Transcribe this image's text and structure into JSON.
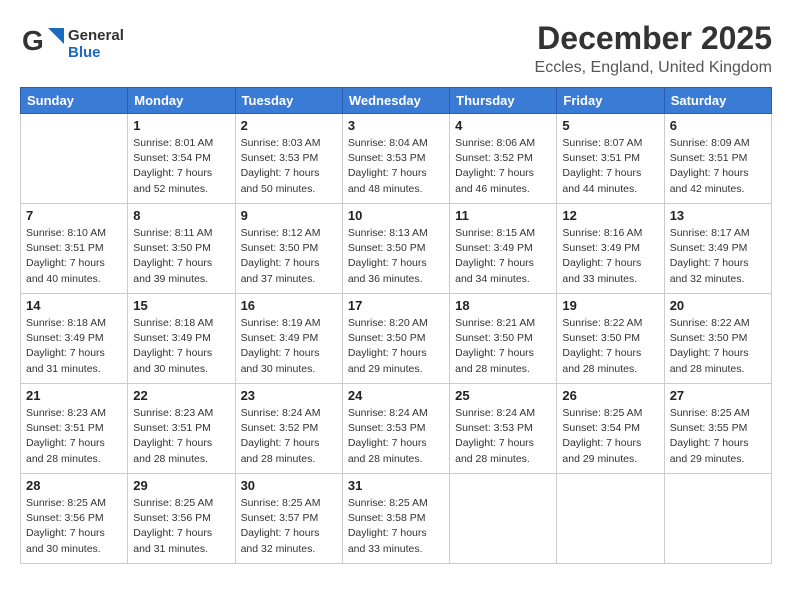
{
  "logo": {
    "general": "General",
    "blue": "Blue"
  },
  "header": {
    "month": "December 2025",
    "location": "Eccles, England, United Kingdom"
  },
  "weekdays": [
    "Sunday",
    "Monday",
    "Tuesday",
    "Wednesday",
    "Thursday",
    "Friday",
    "Saturday"
  ],
  "weeks": [
    [
      {
        "day": "",
        "sunrise": "",
        "sunset": "",
        "daylight": ""
      },
      {
        "day": "1",
        "sunrise": "Sunrise: 8:01 AM",
        "sunset": "Sunset: 3:54 PM",
        "daylight": "Daylight: 7 hours and 52 minutes."
      },
      {
        "day": "2",
        "sunrise": "Sunrise: 8:03 AM",
        "sunset": "Sunset: 3:53 PM",
        "daylight": "Daylight: 7 hours and 50 minutes."
      },
      {
        "day": "3",
        "sunrise": "Sunrise: 8:04 AM",
        "sunset": "Sunset: 3:53 PM",
        "daylight": "Daylight: 7 hours and 48 minutes."
      },
      {
        "day": "4",
        "sunrise": "Sunrise: 8:06 AM",
        "sunset": "Sunset: 3:52 PM",
        "daylight": "Daylight: 7 hours and 46 minutes."
      },
      {
        "day": "5",
        "sunrise": "Sunrise: 8:07 AM",
        "sunset": "Sunset: 3:51 PM",
        "daylight": "Daylight: 7 hours and 44 minutes."
      },
      {
        "day": "6",
        "sunrise": "Sunrise: 8:09 AM",
        "sunset": "Sunset: 3:51 PM",
        "daylight": "Daylight: 7 hours and 42 minutes."
      }
    ],
    [
      {
        "day": "7",
        "sunrise": "Sunrise: 8:10 AM",
        "sunset": "Sunset: 3:51 PM",
        "daylight": "Daylight: 7 hours and 40 minutes."
      },
      {
        "day": "8",
        "sunrise": "Sunrise: 8:11 AM",
        "sunset": "Sunset: 3:50 PM",
        "daylight": "Daylight: 7 hours and 39 minutes."
      },
      {
        "day": "9",
        "sunrise": "Sunrise: 8:12 AM",
        "sunset": "Sunset: 3:50 PM",
        "daylight": "Daylight: 7 hours and 37 minutes."
      },
      {
        "day": "10",
        "sunrise": "Sunrise: 8:13 AM",
        "sunset": "Sunset: 3:50 PM",
        "daylight": "Daylight: 7 hours and 36 minutes."
      },
      {
        "day": "11",
        "sunrise": "Sunrise: 8:15 AM",
        "sunset": "Sunset: 3:49 PM",
        "daylight": "Daylight: 7 hours and 34 minutes."
      },
      {
        "day": "12",
        "sunrise": "Sunrise: 8:16 AM",
        "sunset": "Sunset: 3:49 PM",
        "daylight": "Daylight: 7 hours and 33 minutes."
      },
      {
        "day": "13",
        "sunrise": "Sunrise: 8:17 AM",
        "sunset": "Sunset: 3:49 PM",
        "daylight": "Daylight: 7 hours and 32 minutes."
      }
    ],
    [
      {
        "day": "14",
        "sunrise": "Sunrise: 8:18 AM",
        "sunset": "Sunset: 3:49 PM",
        "daylight": "Daylight: 7 hours and 31 minutes."
      },
      {
        "day": "15",
        "sunrise": "Sunrise: 8:18 AM",
        "sunset": "Sunset: 3:49 PM",
        "daylight": "Daylight: 7 hours and 30 minutes."
      },
      {
        "day": "16",
        "sunrise": "Sunrise: 8:19 AM",
        "sunset": "Sunset: 3:49 PM",
        "daylight": "Daylight: 7 hours and 30 minutes."
      },
      {
        "day": "17",
        "sunrise": "Sunrise: 8:20 AM",
        "sunset": "Sunset: 3:50 PM",
        "daylight": "Daylight: 7 hours and 29 minutes."
      },
      {
        "day": "18",
        "sunrise": "Sunrise: 8:21 AM",
        "sunset": "Sunset: 3:50 PM",
        "daylight": "Daylight: 7 hours and 28 minutes."
      },
      {
        "day": "19",
        "sunrise": "Sunrise: 8:22 AM",
        "sunset": "Sunset: 3:50 PM",
        "daylight": "Daylight: 7 hours and 28 minutes."
      },
      {
        "day": "20",
        "sunrise": "Sunrise: 8:22 AM",
        "sunset": "Sunset: 3:50 PM",
        "daylight": "Daylight: 7 hours and 28 minutes."
      }
    ],
    [
      {
        "day": "21",
        "sunrise": "Sunrise: 8:23 AM",
        "sunset": "Sunset: 3:51 PM",
        "daylight": "Daylight: 7 hours and 28 minutes."
      },
      {
        "day": "22",
        "sunrise": "Sunrise: 8:23 AM",
        "sunset": "Sunset: 3:51 PM",
        "daylight": "Daylight: 7 hours and 28 minutes."
      },
      {
        "day": "23",
        "sunrise": "Sunrise: 8:24 AM",
        "sunset": "Sunset: 3:52 PM",
        "daylight": "Daylight: 7 hours and 28 minutes."
      },
      {
        "day": "24",
        "sunrise": "Sunrise: 8:24 AM",
        "sunset": "Sunset: 3:53 PM",
        "daylight": "Daylight: 7 hours and 28 minutes."
      },
      {
        "day": "25",
        "sunrise": "Sunrise: 8:24 AM",
        "sunset": "Sunset: 3:53 PM",
        "daylight": "Daylight: 7 hours and 28 minutes."
      },
      {
        "day": "26",
        "sunrise": "Sunrise: 8:25 AM",
        "sunset": "Sunset: 3:54 PM",
        "daylight": "Daylight: 7 hours and 29 minutes."
      },
      {
        "day": "27",
        "sunrise": "Sunrise: 8:25 AM",
        "sunset": "Sunset: 3:55 PM",
        "daylight": "Daylight: 7 hours and 29 minutes."
      }
    ],
    [
      {
        "day": "28",
        "sunrise": "Sunrise: 8:25 AM",
        "sunset": "Sunset: 3:56 PM",
        "daylight": "Daylight: 7 hours and 30 minutes."
      },
      {
        "day": "29",
        "sunrise": "Sunrise: 8:25 AM",
        "sunset": "Sunset: 3:56 PM",
        "daylight": "Daylight: 7 hours and 31 minutes."
      },
      {
        "day": "30",
        "sunrise": "Sunrise: 8:25 AM",
        "sunset": "Sunset: 3:57 PM",
        "daylight": "Daylight: 7 hours and 32 minutes."
      },
      {
        "day": "31",
        "sunrise": "Sunrise: 8:25 AM",
        "sunset": "Sunset: 3:58 PM",
        "daylight": "Daylight: 7 hours and 33 minutes."
      },
      {
        "day": "",
        "sunrise": "",
        "sunset": "",
        "daylight": ""
      },
      {
        "day": "",
        "sunrise": "",
        "sunset": "",
        "daylight": ""
      },
      {
        "day": "",
        "sunrise": "",
        "sunset": "",
        "daylight": ""
      }
    ]
  ]
}
